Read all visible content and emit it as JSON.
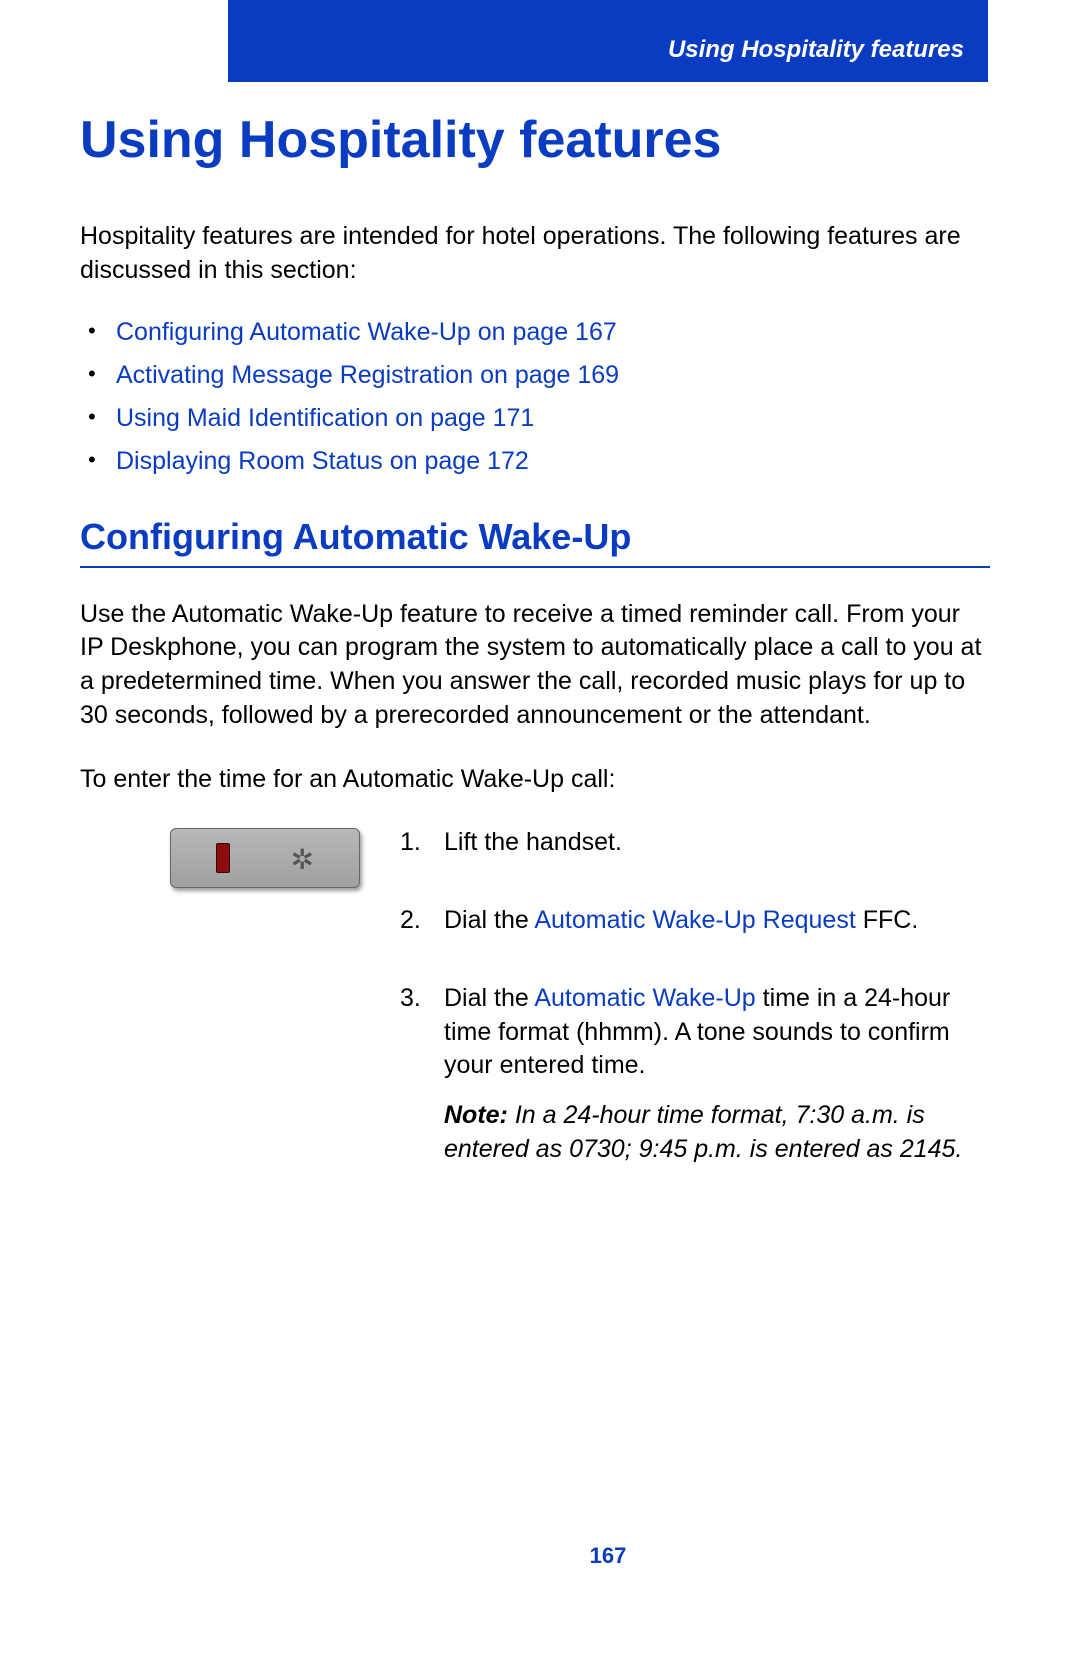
{
  "header": {
    "sectionName": "Using Hospitality features"
  },
  "title": "Using Hospitality features",
  "intro": "Hospitality features are intended for hotel operations. The following features are discussed in this section:",
  "toc": [
    "Configuring Automatic Wake-Up  on page 167",
    "Activating Message Registration  on page 169",
    "Using Maid Identification  on page 171",
    "Displaying Room Status  on page 172"
  ],
  "section": {
    "title": "Configuring Automatic Wake-Up",
    "para1": "Use the Automatic Wake-Up feature to receive a timed reminder call. From your IP Deskphone, you can program the system to automatically place a call to you at a predetermined time. When you answer the call, recorded music plays for up to 30 seconds, followed by a prerecorded announcement or the attendant.",
    "para2": "To enter the time for an Automatic Wake-Up call:"
  },
  "steps": [
    {
      "num": "1.",
      "pre": "Lift the handset.",
      "link": "",
      "post": "",
      "note": ""
    },
    {
      "num": "2.",
      "pre": "Dial the ",
      "link": "Automatic Wake-Up Request",
      "post": " FFC.",
      "note": ""
    },
    {
      "num": "3.",
      "pre": "Dial the ",
      "link": "Automatic Wake-Up ",
      "post": " time in a 24-hour time format (hhmm). A tone sounds to confirm your entered time.",
      "noteLabel": "Note:",
      "note": " In a 24-hour time format, 7:30 a.m. is entered as 0730; 9:45 p.m. is entered as 2145."
    }
  ],
  "pageNumber": "167"
}
